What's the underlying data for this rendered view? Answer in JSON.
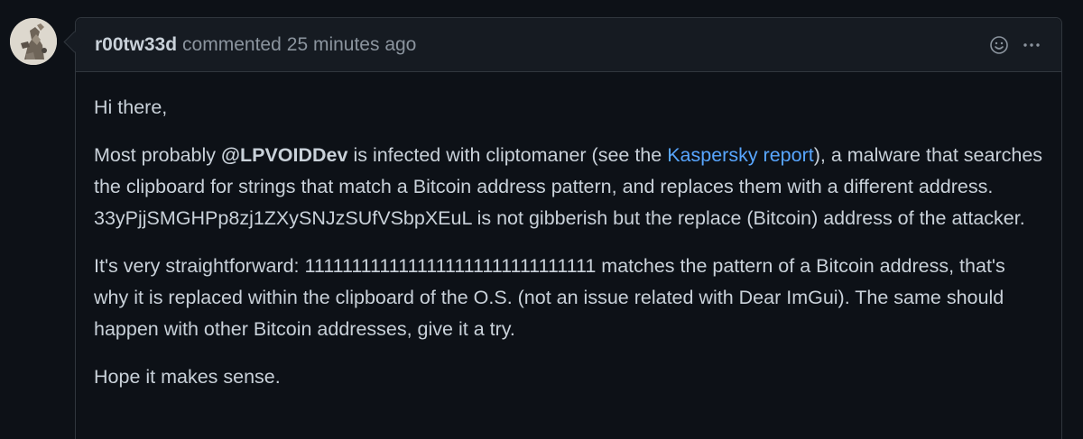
{
  "comment": {
    "author": "r00tw33d",
    "action": "commented",
    "time": "25 minutes ago",
    "paragraphs": {
      "greeting": "Hi there,",
      "p2": {
        "part1": "Most probably ",
        "mention": "@LPVOIDDev",
        "part2": " is infected with cliptomaner (see the ",
        "link_text": "Kaspersky report",
        "part3": "), a malware that searches the clipboard for strings that match a Bitcoin address pattern, and replaces them with a different address. 33yPjjSMGHPp8zj1ZXySNJzSUfVSbpXEuL is not gibberish but the replace (Bitcoin) address of the attacker."
      },
      "p3": "It's very straightforward: 1111111111111111111111111111111 matches the pattern of a Bitcoin address, that's why it is replaced within the clipboard of the O.S. (not an issue related with Dear ImGui). The same should happen with other Bitcoin addresses, give it a try.",
      "closing": "Hope it makes sense."
    }
  },
  "icons": {
    "reaction": "smiley-icon",
    "more": "kebab-horizontal-icon"
  },
  "colors": {
    "background": "#0d1117",
    "header": "#161b22",
    "border": "#30363d",
    "text": "#c9d1d9",
    "muted": "#8b949e",
    "link": "#58a6ff"
  }
}
